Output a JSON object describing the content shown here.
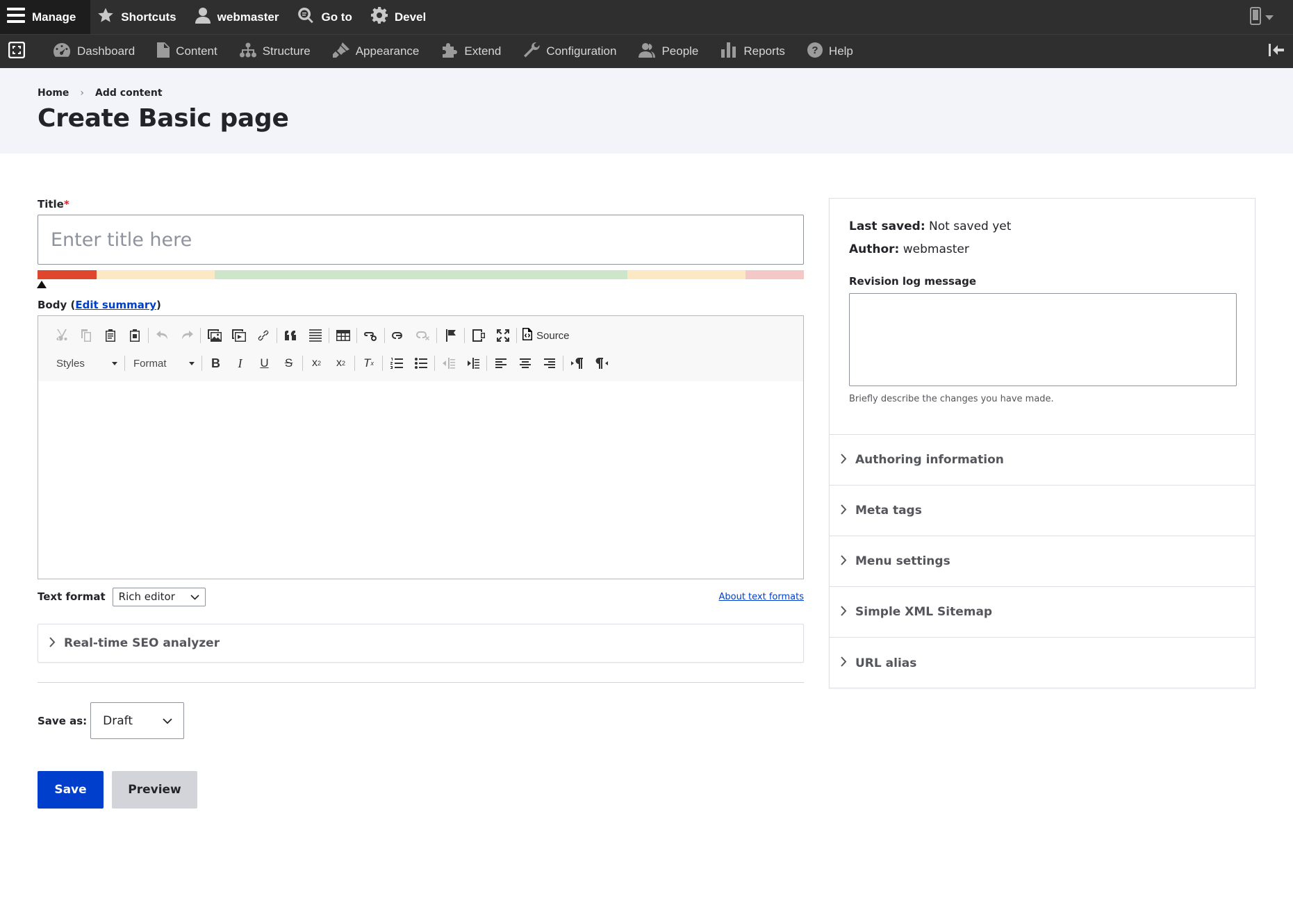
{
  "toolbar": {
    "manage": "Manage",
    "shortcuts": "Shortcuts",
    "user": "webmaster",
    "goto": "Go to",
    "devel": "Devel"
  },
  "tray": {
    "items": [
      "Dashboard",
      "Content",
      "Structure",
      "Appearance",
      "Extend",
      "Configuration",
      "People",
      "Reports",
      "Help"
    ]
  },
  "breadcrumb": {
    "home": "Home",
    "sep": "›",
    "current": "Add content"
  },
  "page_title": "Create Basic page",
  "form": {
    "title_label": "Title",
    "required_mark": "*",
    "title_placeholder": "Enter title here",
    "body_label_prefix": "Body (",
    "body_edit_summary": "Edit summary",
    "body_label_suffix": ")",
    "source_label": "Source",
    "styles_label": "Styles",
    "format_label": "Format",
    "text_format_label": "Text format",
    "text_format_value": "Rich editor",
    "about_text_formats": "About text formats",
    "seo_analyzer": "Real-time SEO analyzer",
    "save_as_label": "Save as:",
    "save_as_value": "Draft",
    "save_button": "Save",
    "preview_button": "Preview"
  },
  "seo_bar_colors": [
    "#e0452e",
    "#fde8c4",
    "#cde5c8",
    "#fde8c4",
    "#f5c8c8"
  ],
  "sidebar": {
    "last_saved_label": "Last saved:",
    "last_saved_value": "Not saved yet",
    "author_label": "Author:",
    "author_value": "webmaster",
    "revision_label": "Revision log message",
    "revision_description": "Briefly describe the changes you have made.",
    "sections": [
      "Authoring information",
      "Meta tags",
      "Menu settings",
      "Simple XML Sitemap",
      "URL alias"
    ]
  },
  "colors": {
    "toolbar_bg": "#2f2f2f",
    "header_bg": "#f3f4f9",
    "primary": "#003ecc",
    "secondary_btn": "#d3d4d9"
  }
}
